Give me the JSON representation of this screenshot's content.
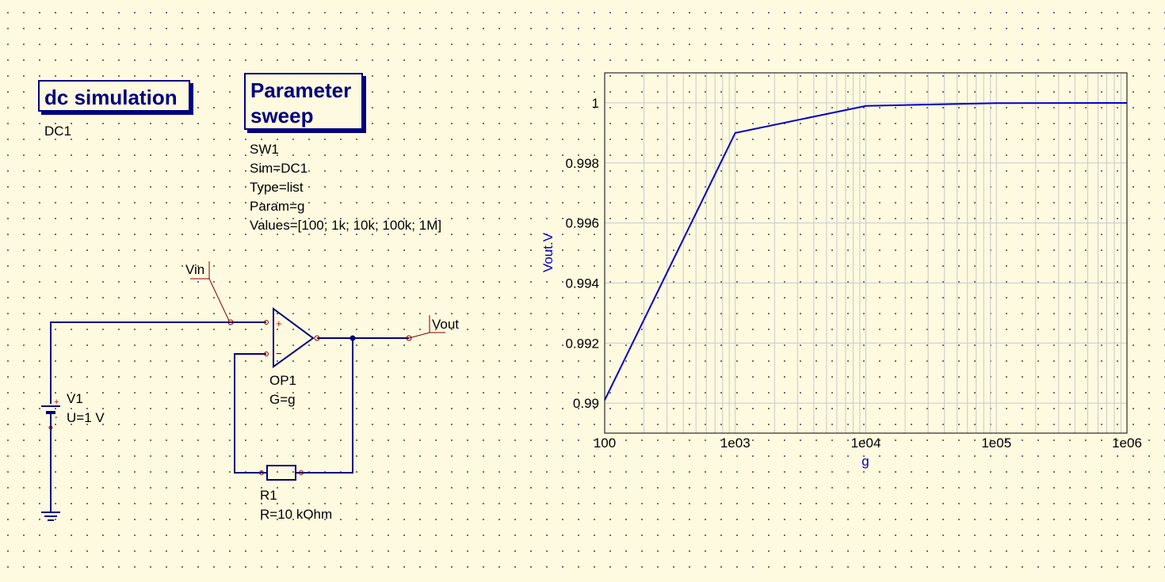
{
  "simulation": {
    "title": "dc simulation",
    "name": "DC1"
  },
  "sweep": {
    "title_line1": "Parameter",
    "title_line2": "sweep",
    "props": [
      "SW1",
      "Sim=DC1",
      "Type=list",
      "Param=g",
      "Values=[100; 1k; 10k; 100k; 1M]"
    ]
  },
  "schematic": {
    "vin_label": "Vin",
    "vout_label": "Vout",
    "source": {
      "name": "V1",
      "value": "U=1 V"
    },
    "opamp": {
      "name": "OP1",
      "value": "G=g",
      "plus": "+",
      "minus": "−"
    },
    "resistor": {
      "name": "R1",
      "value": "R=10 kOhm"
    },
    "wire_color": "#00007f",
    "port_color": "#800000"
  },
  "chart_data": {
    "type": "line",
    "xscale": "log",
    "xlabel": "g",
    "ylabel": "Vout.V",
    "xlim": [
      100,
      1000000
    ],
    "ylim": [
      0.989,
      1.001
    ],
    "xticks": [
      100,
      1000,
      10000,
      100000,
      1000000
    ],
    "xtick_labels": [
      "100",
      "1e03",
      "1e04",
      "1e05",
      "1e06"
    ],
    "yticks": [
      0.99,
      0.992,
      0.994,
      0.996,
      0.998,
      1
    ],
    "ytick_labels": [
      "0.99",
      "0.992",
      "0.994",
      "0.996",
      "0.998",
      "1"
    ],
    "grid": true,
    "series": [
      {
        "x": [
          100,
          1000,
          10000,
          100000,
          1000000
        ],
        "y": [
          0.9901,
          0.999,
          0.9999,
          0.99999,
          0.999999
        ],
        "color": "#0000cc"
      }
    ],
    "axis_label_color": "#0000cc"
  }
}
